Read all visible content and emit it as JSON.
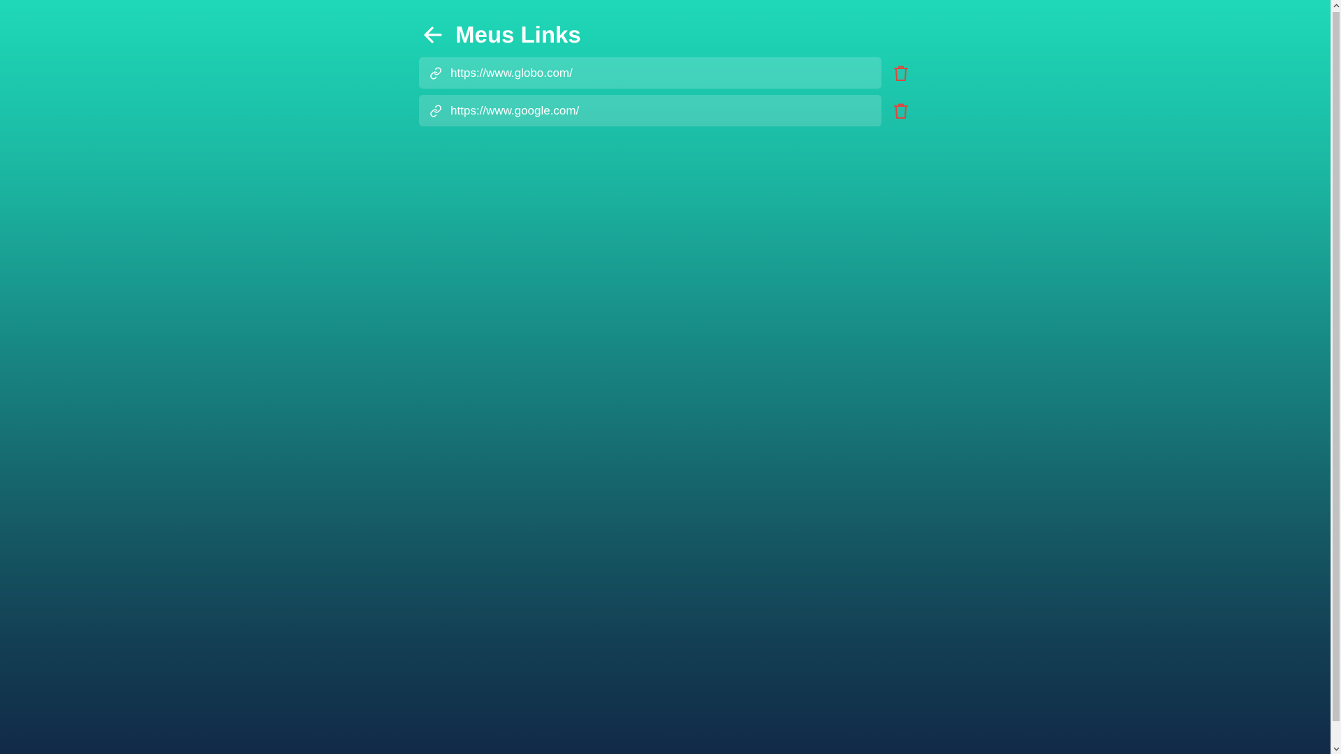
{
  "header": {
    "title": "Meus Links",
    "back_icon": "arrow-left-icon"
  },
  "links": [
    {
      "url": "https://www.globo.com/",
      "icon": "link-icon",
      "action_icon": "trash-icon"
    },
    {
      "url": "https://www.google.com/",
      "icon": "link-icon",
      "action_icon": "trash-icon"
    }
  ],
  "colors": {
    "gradient_top": "#1ed9b8",
    "gradient_bottom": "#112a47",
    "delete": "#e0463c",
    "text": "#ffffff"
  }
}
